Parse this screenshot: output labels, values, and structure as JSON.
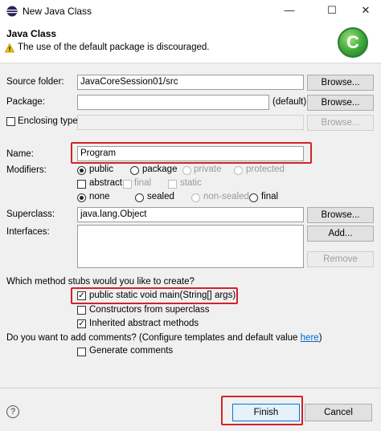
{
  "window": {
    "title": "New Java Class",
    "minimize": "—",
    "maximize": "☐",
    "close": "✕"
  },
  "header": {
    "title": "Java Class",
    "warning": "The use of the default package is discouraged.",
    "logo_letter": "C"
  },
  "form": {
    "source_folder": {
      "label": "Source folder:",
      "value": "JavaCoreSession01/src",
      "browse": "Browse..."
    },
    "package": {
      "label": "Package:",
      "value": "",
      "default_text": "(default)",
      "browse": "Browse..."
    },
    "enclosing_type": {
      "label": "Enclosing type:",
      "value": "",
      "browse": "Browse..."
    },
    "name": {
      "label": "Name:",
      "value": "Program"
    },
    "modifiers": {
      "label": "Modifiers:",
      "access": [
        "public",
        "package",
        "private",
        "protected"
      ],
      "flags": [
        "abstract",
        "final",
        "static"
      ],
      "sealed": [
        "none",
        "sealed",
        "non-sealed",
        "final"
      ]
    },
    "superclass": {
      "label": "Superclass:",
      "value": "java.lang.Object",
      "browse": "Browse..."
    },
    "interfaces": {
      "label": "Interfaces:",
      "add": "Add...",
      "remove": "Remove"
    },
    "stubs": {
      "question": "Which method stubs would you like to create?",
      "items": [
        "public static void main(String[] args)",
        "Constructors from superclass",
        "Inherited abstract methods"
      ]
    },
    "comments": {
      "question": "Do you want to add comments? (Configure templates and default value ",
      "link": "here",
      "question_end": ")",
      "generate": "Generate comments"
    }
  },
  "footer": {
    "help": "?",
    "finish": "Finish",
    "cancel": "Cancel"
  },
  "colors": {
    "highlight": "#d2232a",
    "link": "#0066cc",
    "logo": "#3aa537"
  }
}
